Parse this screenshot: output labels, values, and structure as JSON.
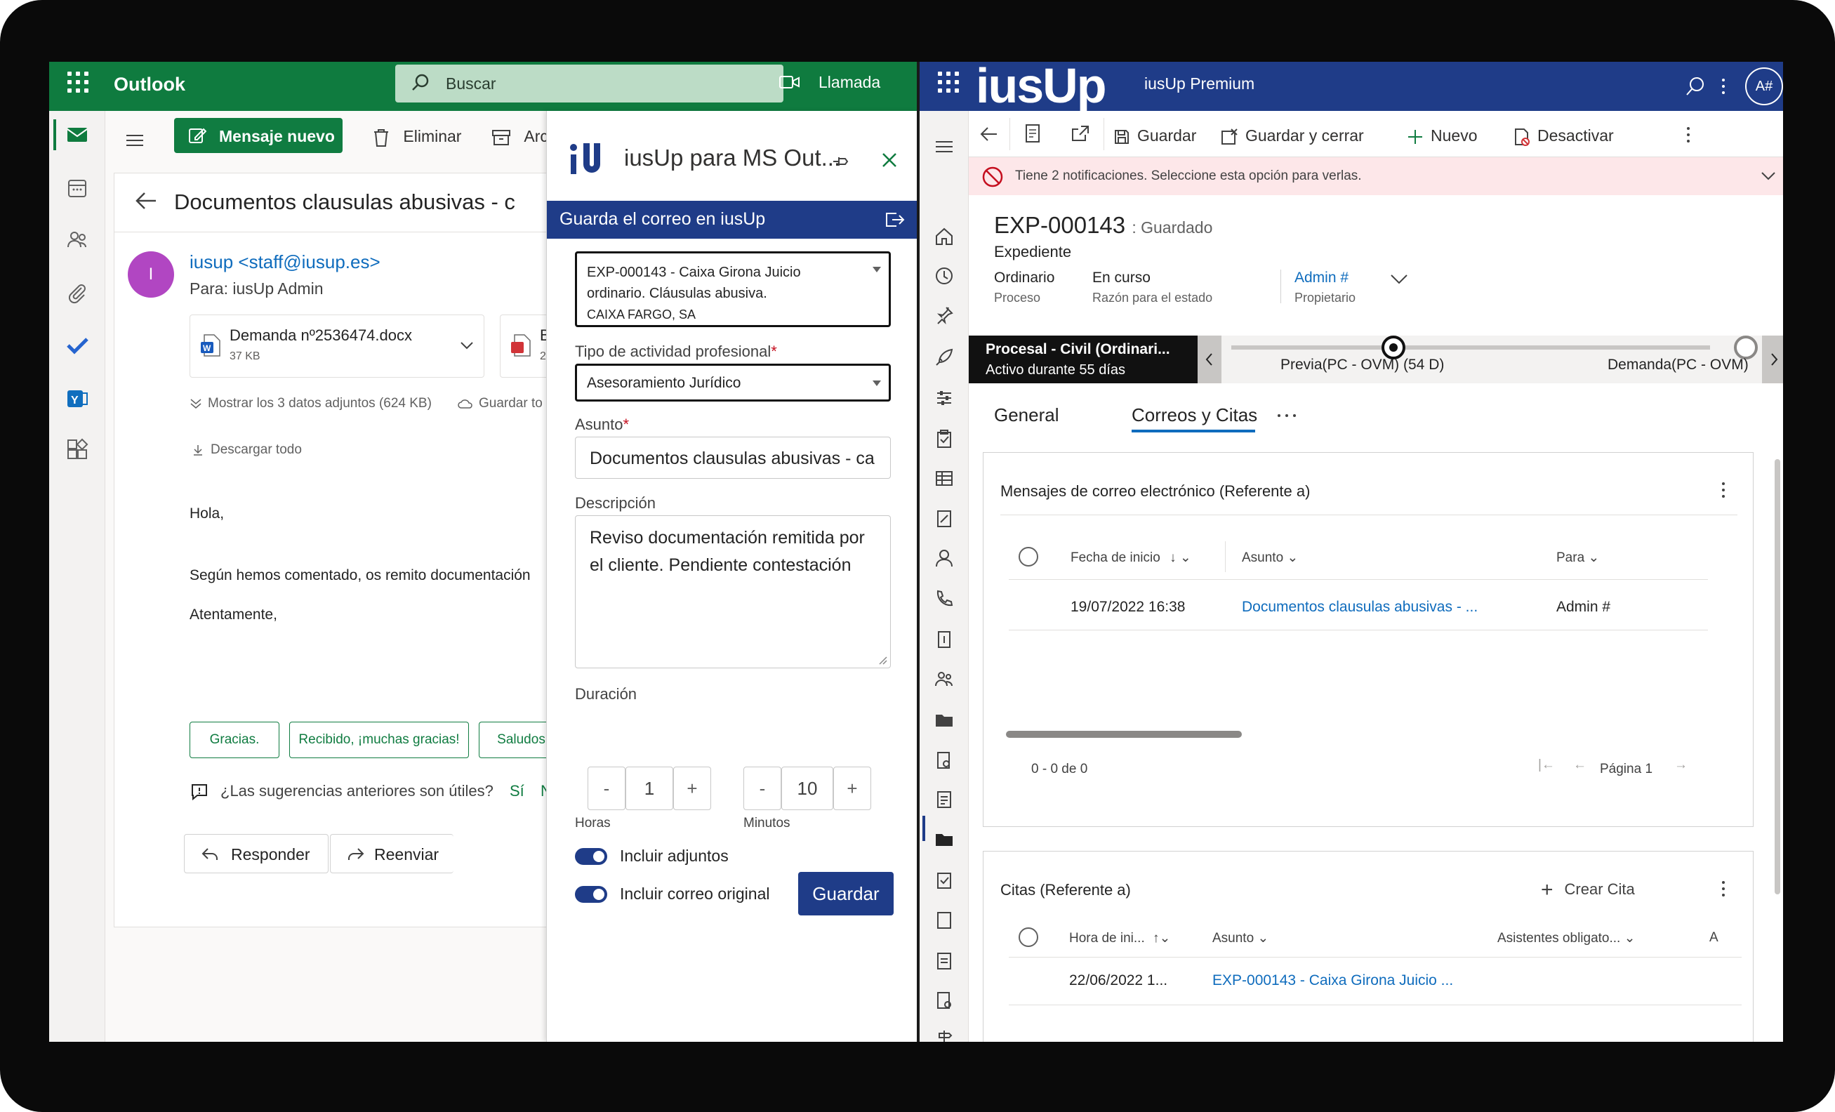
{
  "outlook": {
    "app_name": "Outlook",
    "search_placeholder": "Buscar",
    "call_label": "Llamada",
    "new_message": "Mensaje nuevo",
    "delete": "Eliminar",
    "archive": "Arc",
    "subject": "Documentos clausulas abusivas - c",
    "sender_initial": "I",
    "sender": "iusup <staff@iusup.es>",
    "to": "Para:  iusUp Admin",
    "attachment_1_name": "Demanda nº2536474.docx",
    "attachment_1_size": "37 KB",
    "attachment_2_name": "B",
    "attachment_2_size": "2",
    "show_attachments": "Mostrar los 3 datos adjuntos (624 KB)",
    "save_all": "Guardar to",
    "download_all": "Descargar todo",
    "body_greeting": "Hola,",
    "body_line": "Según hemos comentado, os remito documentación",
    "body_sign": "Atentamente,",
    "suggestions": [
      "Gracias.",
      "Recibido, ¡muchas gracias!",
      "Saludos"
    ],
    "feedback_q": "¿Las sugerencias anteriores son útiles?",
    "feedback_yes": "Sí",
    "feedback_no": "N",
    "reply": "Responder",
    "forward": "Reenviar"
  },
  "addin": {
    "title": "iusUp para MS Out...",
    "bar_title": "Guarda el correo en iusUp",
    "record_line1": "EXP-000143 - Caixa Girona Juicio",
    "record_line2": "ordinario. Cláusulas abusiva.",
    "record_line3": "CAIXA FARGO, SA",
    "activity_label": "Tipo de actividad profesional",
    "activity_value": "Asesoramiento Jurídico",
    "subject_label": "Asunto",
    "subject_value": "Documentos clausulas abusivas - ca",
    "desc_label": "Descripción",
    "desc_value": "Reviso documentación remitida por el cliente. Pendiente contestación",
    "duration_label": "Duración",
    "hours_value": "1",
    "minutes_value": "10",
    "minus": "-",
    "plus": "+",
    "hours_label": "Horas",
    "minutes_label": "Minutos",
    "include_attachments": "Incluir adjuntos",
    "include_original": "Incluir correo original",
    "save": "Guardar",
    "required_mark": "*"
  },
  "iusup": {
    "logo": "iusUp",
    "product": "iusUp Premium",
    "avatar": "A#",
    "cmd_save": "Guardar",
    "cmd_save_close": "Guardar y cerrar",
    "cmd_new": "Nuevo",
    "cmd_deactivate": "Desactivar",
    "notification": "Tiene 2 notificaciones. Seleccione esta opción para verlas.",
    "record_id": "EXP-000143",
    "record_state": ": Guardado",
    "record_type": "Expediente",
    "process_value": "Ordinario",
    "process_label": "Proceso",
    "status_value": "En curso",
    "status_label": "Razón para el estado",
    "owner_value": "Admin #",
    "owner_label": "Propietario",
    "bpf_active_name": "Procesal - Civil (Ordinari...",
    "bpf_active_time": "Activo durante 55 días",
    "stage_1": "Previa(PC - OVM)  (54 D)",
    "stage_2": "Demanda(PC - OVM)",
    "tab_general": "General",
    "tab_emails": "Correos y Citas",
    "emails_title": "Mensajes de correo electrónico (Referente a)",
    "col_start": "Fecha de inicio",
    "col_subject": "Asunto",
    "col_to": "Para",
    "email_row_date": "19/07/2022 16:38",
    "email_row_subject": "Documentos clausulas abusivas - ...",
    "email_row_to": "Admin #",
    "pager_count": "0 - 0 de 0",
    "pager_page": "Página 1",
    "appts_title": "Citas (Referente a)",
    "create_appt": "Crear Cita",
    "col_hour": "Hora de ini...",
    "col_attendees": "Asistentes obligato...",
    "col_a": "A",
    "appt_row_date": "22/06/2022 1...",
    "appt_row_subject": "EXP-000143 - Caixa Girona Juicio ...",
    "nav_badge": "A"
  },
  "colors": {
    "outlook_green": "#0f7b3f",
    "iusup_blue": "#1f3c88",
    "link_blue": "#0f6cbd",
    "notification_bg": "#fde7e9"
  }
}
